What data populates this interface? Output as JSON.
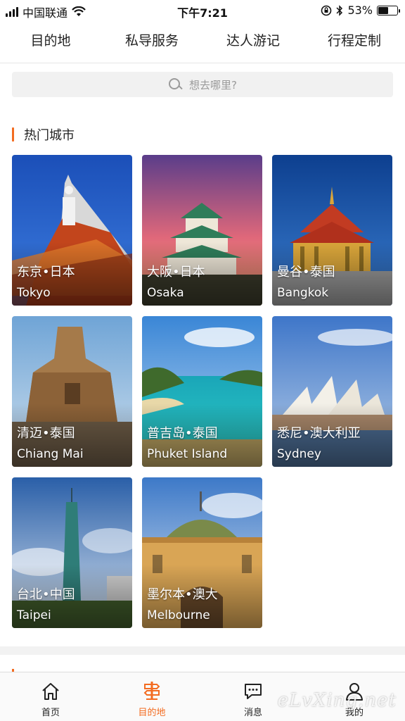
{
  "status_bar": {
    "carrier": "中国联通",
    "time": "下午7:21",
    "battery": "53%",
    "battery_level": 0.53
  },
  "tabs": [
    {
      "label": "目的地",
      "active": true
    },
    {
      "label": "私导服务",
      "active": false
    },
    {
      "label": "达人游记",
      "active": false
    },
    {
      "label": "行程定制",
      "active": false
    }
  ],
  "search": {
    "placeholder": "想去哪里?"
  },
  "section": {
    "title": "热门城市"
  },
  "cities": [
    {
      "cn": "东京•日本",
      "en": "Tokyo"
    },
    {
      "cn": "大阪•日本",
      "en": "Osaka"
    },
    {
      "cn": "曼谷•泰国",
      "en": "Bangkok"
    },
    {
      "cn": "清迈•泰国",
      "en": "Chiang Mai"
    },
    {
      "cn": "普吉岛•泰国",
      "en": "Phuket Island"
    },
    {
      "cn": "悉尼•澳大利亚",
      "en": "Sydney"
    },
    {
      "cn": "台北•中国",
      "en": "Taipei"
    },
    {
      "cn": "墨尔本•澳大",
      "en": "Melbourne"
    }
  ],
  "bottom_nav": [
    {
      "label": "首页",
      "icon": "home-icon",
      "active": false
    },
    {
      "label": "目的地",
      "icon": "signpost-icon",
      "active": true
    },
    {
      "label": "消息",
      "icon": "message-icon",
      "active": false
    },
    {
      "label": "我的",
      "icon": "user-icon",
      "active": false
    }
  ],
  "watermark": "eLvXing.net",
  "colors": {
    "accent": "#f36c21"
  }
}
